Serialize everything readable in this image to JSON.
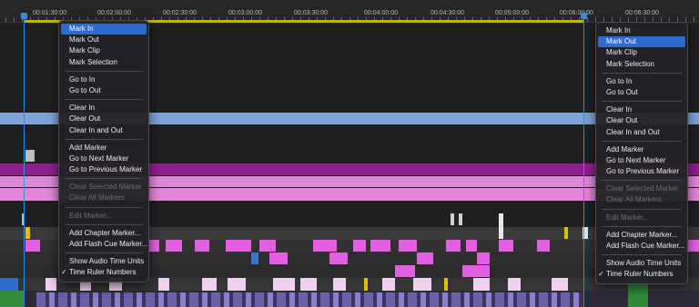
{
  "ruler": {
    "timecodes": [
      "00:01:30:00",
      "00:02:00:00",
      "00:02:30:00",
      "00:03:00:00",
      "00:03:30:00",
      "00:04:00:00",
      "00:04:30:00",
      "00:05:00:00",
      "00:05:30:00",
      "00:06:00:00",
      "00:06:30:00"
    ]
  },
  "colors": {
    "playhead": "#3b8bdb",
    "in_out_bar": "#c7b100",
    "menu_highlight": "#2f6bcb",
    "clip_blue": "#7fa3d6",
    "clip_purple": "#8e1f8e",
    "clip_pink": "#e386d9",
    "clip_magenta": "#d04ed8"
  },
  "menu_left": {
    "items": [
      {
        "label": "Mark In",
        "state": "selected"
      },
      {
        "label": "Mark Out",
        "state": "normal"
      },
      {
        "label": "Mark Clip",
        "state": "normal"
      },
      {
        "label": "Mark Selection",
        "state": "normal"
      },
      {
        "sep": true
      },
      {
        "label": "Go to In",
        "state": "normal"
      },
      {
        "label": "Go to Out",
        "state": "normal"
      },
      {
        "sep": true
      },
      {
        "label": "Clear In",
        "state": "normal"
      },
      {
        "label": "Clear Out",
        "state": "normal"
      },
      {
        "label": "Clear In and Out",
        "state": "normal"
      },
      {
        "sep": true
      },
      {
        "label": "Add Marker",
        "state": "normal"
      },
      {
        "label": "Go to Next Marker",
        "state": "normal"
      },
      {
        "label": "Go to Previous Marker",
        "state": "normal"
      },
      {
        "sep": true
      },
      {
        "label": "Clear Selected Marker",
        "state": "disabled"
      },
      {
        "label": "Clear All Markers",
        "state": "disabled"
      },
      {
        "sep": true
      },
      {
        "label": "Edit Marker...",
        "state": "disabled"
      },
      {
        "sep": true
      },
      {
        "label": "Add Chapter Marker...",
        "state": "normal"
      },
      {
        "label": "Add Flash Cue Marker...",
        "state": "normal"
      },
      {
        "sep": true
      },
      {
        "label": "Show Audio Time Units",
        "state": "normal"
      },
      {
        "label": "Time Ruler Numbers",
        "state": "normal",
        "checked": true
      }
    ]
  },
  "menu_right": {
    "items": [
      {
        "label": "Mark In",
        "state": "normal"
      },
      {
        "label": "Mark Out",
        "state": "selected"
      },
      {
        "label": "Mark Clip",
        "state": "normal"
      },
      {
        "label": "Mark Selection",
        "state": "normal"
      },
      {
        "sep": true
      },
      {
        "label": "Go to In",
        "state": "normal"
      },
      {
        "label": "Go to Out",
        "state": "normal"
      },
      {
        "sep": true
      },
      {
        "label": "Clear In",
        "state": "normal"
      },
      {
        "label": "Clear Out",
        "state": "normal"
      },
      {
        "label": "Clear In and Out",
        "state": "normal"
      },
      {
        "sep": true
      },
      {
        "label": "Add Marker",
        "state": "normal"
      },
      {
        "label": "Go to Next Marker",
        "state": "normal"
      },
      {
        "label": "Go to Previous Marker",
        "state": "normal"
      },
      {
        "sep": true
      },
      {
        "label": "Clear Selected Marker",
        "state": "disabled"
      },
      {
        "label": "Clear All Markers",
        "state": "disabled"
      },
      {
        "sep": true
      },
      {
        "label": "Edit Marker...",
        "state": "disabled"
      },
      {
        "sep": true
      },
      {
        "label": "Add Chapter Marker...",
        "state": "normal"
      },
      {
        "label": "Add Flash Cue Marker...",
        "state": "normal"
      },
      {
        "sep": true
      },
      {
        "label": "Show Audio Time Units",
        "state": "normal"
      },
      {
        "label": "Time Ruler Numbers",
        "state": "normal",
        "checked": true
      }
    ]
  }
}
